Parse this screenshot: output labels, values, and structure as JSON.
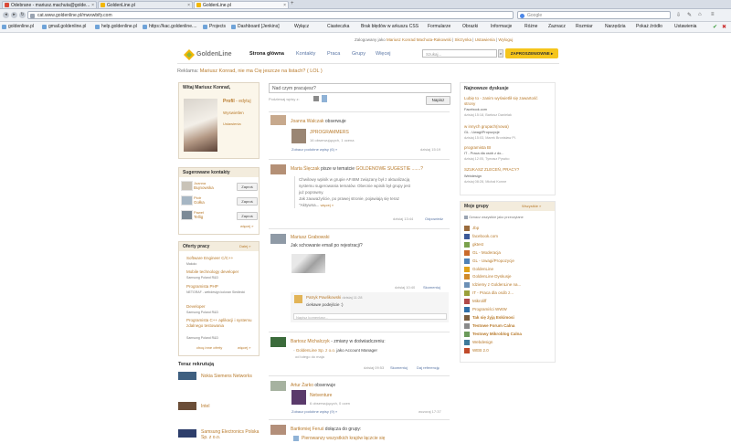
{
  "browser": {
    "tabs": [
      {
        "label": "Odebrane - mariusz.machuta@golde...",
        "favicon_color": "#d94a3a"
      },
      {
        "label": "GoldenLine.pl",
        "favicon_color": "#f2b705"
      },
      {
        "label": "GoldenLine.pl",
        "favicon_color": "#f2b705"
      }
    ],
    "url": "cat.www.goldenline.pl/mwxwbify.com",
    "search_placeholder": "Google",
    "bookmarks": [
      "goldenline.pl",
      "gmail.goldenline.pl",
      "help.goldenline.pl",
      "https://kac.goldenline....",
      "Projects",
      "Dashboard [Jenkins]"
    ],
    "toolbar_right": [
      "Wyłącz",
      "Ciasteczka",
      "Brak błędów w arkuszu CSS",
      "Formularze",
      "Obrazki",
      "Informacje",
      "Różne",
      "Zaznacz",
      "Rozmiar",
      "Narzędzia",
      "Pokaż źródło",
      "Ustawienia"
    ]
  },
  "site": {
    "toplinks_prefix": "Zalogowany jako",
    "user_name": "Mariusz Konrad Machuta-Rakowski",
    "toplinks": [
      "Skrzynka",
      "Ustawienia",
      "Wyloguj"
    ],
    "logo_text": "GoldenLine",
    "nav": [
      "Strona główna",
      "Kontakty",
      "Praca",
      "Grupy",
      "Więcej"
    ],
    "search_placeholder": "Szukaj...",
    "cta_label": "ZAPROSZENIOWNE ▸",
    "ad_prefix": "Reklama:",
    "ad_text": "Mariusz Konrad, nie ma Cię jeszcze na listach? ( LOL )"
  },
  "profile": {
    "greeting": "Witaj Mariusz Konrad,",
    "profile_label": "Profil",
    "edit_label": "- edytuj",
    "visits_label": "Wyswietlen",
    "settings_label": "Ustawienia"
  },
  "suggested": {
    "title": "Sugerowane kontakty",
    "items": [
      {
        "name": "Joanna",
        "sub": "Bujnowska"
      },
      {
        "name": "Piotr",
        "sub": "Gołka"
      },
      {
        "name": "Paweł",
        "sub": "Tellig"
      }
    ],
    "invite_label": "Zaproś",
    "more_label": "więcej »"
  },
  "jobs": {
    "title": "Oferty pracy",
    "more_top": "Dalej »",
    "items": [
      {
        "title": "Software Engineer C/C++",
        "sub": "Makolo"
      },
      {
        "title": "Mobile technology developer",
        "sub": "Samsung Poland R&D"
      },
      {
        "title": "Programista PHP",
        "sub": "NETGRAF - webdesign koloran Siedlecki"
      },
      {
        "title": "Developer",
        "sub": "Samsung Poland R&D"
      },
      {
        "title": "Programista C++ aplikacji i systemu zdalnego testowania",
        "sub": "Samsung Poland R&D"
      }
    ],
    "footer_link": "chcę inne oferty",
    "footer_more": "więcej »"
  },
  "recruiting": {
    "title": "Teraz rekrutują",
    "items": [
      "Nokia Siemens Networks",
      "Intel",
      "Samsung Electronics Polska Sp. z o.o."
    ]
  },
  "feed": {
    "status_placeholder": "Nad czym pracujesz?",
    "attach_label": "Podziewaj wpisy z:",
    "post_button": "Napisz",
    "items": [
      {
        "author": "Joanna Walczak",
        "action": "obserwuje",
        "obj": "JPROGRAMMERS",
        "obj_sub": "16 obserwujących, 1 ocena",
        "footer": "Zobacz podobne wpisy (6) »",
        "time": "dzisiaj 15:19"
      },
      {
        "author": "Marta Ślęczak",
        "action": "pisze w tematcie",
        "topic": "GOLDENOWE SUGESTIE .......?",
        "quote": [
          "Chwilowy wpisik w grupie AF48M związany był z aktualizacją",
          "systemu sugerowania tematów. Obecnie wpisik był grupy jest",
          "już poprawny.",
          "Jak zauważyście, po prawej stronie, pojawiają się teraz",
          "\"Aktywna..."
        ],
        "more": "więcej »",
        "time": "dzisiaj 13:44",
        "reply": "Odpowiedz"
      },
      {
        "author": "Mariusz Grabowski",
        "text": "Jak schowanie email po rejestracji?",
        "time": "dzisiaj 10:40",
        "reply": "Skomentuj",
        "comment_author": "Patryk Pawlikowski",
        "comment_time": "dzisiaj 11:28",
        "comment_text": "ciekawe podejście :)",
        "comment_placeholder": "Napisz komentarz..."
      },
      {
        "author": "Bartosz Michalczyk",
        "action": "- zmiany w doświadczeniu:",
        "line1": "GoldenLine Sp. z o.o.",
        "line1b": "jako Account Manager",
        "line2": "od lutego do maja",
        "time": "dzisiaj 09:53",
        "reply": "Skomentuj",
        "ref": "Daj referencję"
      },
      {
        "author": "Artur Żarko",
        "action": "obserwuje",
        "obj": "Netventure",
        "obj_sub": "6 obserwujących, 0 ocen",
        "footer": "Zobacz podobne wpisy (9) »",
        "time": "wczoraj 17:37"
      },
      {
        "author": "Bartłomiej Feruś",
        "action": "dołącza do grupy:",
        "obj": "Pierowanzy wszystkich krajów łączcie się"
      }
    ]
  },
  "discussions": {
    "title": "Najnowsze dyskusje",
    "items": [
      {
        "title": "Lubię to - zanim wyświetlił się zawartość strony",
        "sub": "Facebook.com",
        "meta": "dzisiaj 15:18, Bartosz Danielak"
      },
      {
        "title": "w innych grupach(nowa)",
        "sub": "GL - Uwagi/Propozycje",
        "meta": "dzisiaj 15:03, Marek Bronisław Pl."
      },
      {
        "title": "programista BI",
        "sub": "IT - Praca dla osób z do...",
        "meta": "dzisiaj 12:05, Tymasz Pyszko"
      },
      {
        "title": "SZUKASZ ZLECEŃ, PRACY?",
        "sub": "Webdesign",
        "meta": "dzisiaj 08:28, Michał Konne"
      }
    ]
  },
  "groups": {
    "title": "Moje grupy",
    "right_link": "Wszystkie »",
    "hint": "Oznacz wszystkie jako przeczytane",
    "items": [
      {
        "label": "Jbp",
        "bold": false
      },
      {
        "label": "facebook.com",
        "bold": false
      },
      {
        "label": "gktest",
        "bold": false
      },
      {
        "label": "GL - Moderacja",
        "bold": false
      },
      {
        "label": "GL - Uwagi/Propozycje",
        "bold": false
      },
      {
        "label": "GoldenLine",
        "bold": false
      },
      {
        "label": "GoldenLine Dyskusje",
        "bold": false
      },
      {
        "label": "Idziemy z GoldenLine na...",
        "bold": false
      },
      {
        "label": "IT - Praca dla osób z...",
        "bold": false
      },
      {
        "label": "Mikroliff",
        "bold": false
      },
      {
        "label": "Programiści WWW",
        "bold": false
      },
      {
        "label": "Tak się żyją Eskimosi",
        "bold": true
      },
      {
        "label": "Testowe Forum Calna",
        "bold": true
      },
      {
        "label": "Testowy Mikroblog Calna",
        "bold": true
      },
      {
        "label": "Webdesign",
        "bold": false
      },
      {
        "label": "WEB 2.0",
        "bold": false
      }
    ]
  }
}
